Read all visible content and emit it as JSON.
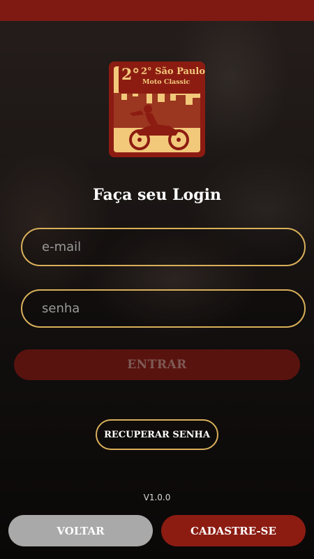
{
  "logo": {
    "line1": "2° São Paulo",
    "line2": "Moto Classic",
    "icon": "motorcycle-rider-logo"
  },
  "login": {
    "title": "Faça seu Login",
    "email_placeholder": "e-mail",
    "password_placeholder": "senha",
    "enter_label": "ENTRAR",
    "recover_label": "RECUPERAR SENHA"
  },
  "footer": {
    "version": "V1.0.0",
    "back_label": "VOLTAR",
    "register_label": "CADASTRE-SE"
  },
  "colors": {
    "status_bar": "#7e1a12",
    "accent_gold": "#d9b05a",
    "brand_red": "#8c1c12",
    "secondary_gray": "#a9a9a9"
  }
}
